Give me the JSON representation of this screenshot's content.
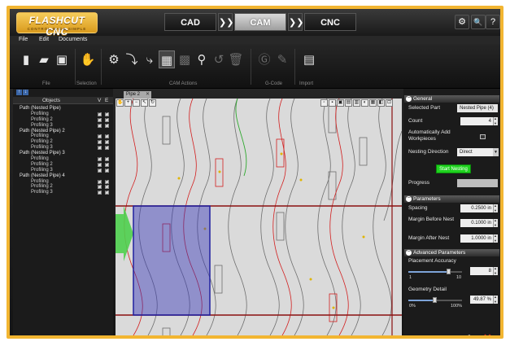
{
  "logo": {
    "title": "FLASHCUT CNC",
    "tagline": "CONTROL MADE SIMPLE"
  },
  "modes": {
    "cad": "CAD",
    "cam": "CAM",
    "cnc": "CNC",
    "chevron": "❯❯"
  },
  "toolbar_right": {
    "settings": "⚙",
    "search": "🔍",
    "help": "?"
  },
  "menu": {
    "file": "File",
    "edit": "Edit",
    "documents": "Documents"
  },
  "ribbon_groups": {
    "file": "File",
    "selection": "Selection",
    "cam_actions": "CAM Actions",
    "gcode": "G-Code",
    "import": "Import"
  },
  "tree": {
    "header": "Objects",
    "col_v": "V",
    "col_e": "E",
    "rows": [
      {
        "label": "Path (Nested Pipe)",
        "type": "parent"
      },
      {
        "label": "Profiling",
        "type": "child"
      },
      {
        "label": "Profiling 2",
        "type": "child"
      },
      {
        "label": "Profiling 3",
        "type": "child"
      },
      {
        "label": "Path (Nested Pipe) 2",
        "type": "parent"
      },
      {
        "label": "Profiling",
        "type": "child"
      },
      {
        "label": "Profiling 2",
        "type": "child"
      },
      {
        "label": "Profiling 3",
        "type": "child"
      },
      {
        "label": "Path (Nested Pipe) 3",
        "type": "parent"
      },
      {
        "label": "Profiling",
        "type": "child"
      },
      {
        "label": "Profiling 2",
        "type": "child"
      },
      {
        "label": "Profiling 3",
        "type": "child"
      },
      {
        "label": "Path (Nested Pipe) 4",
        "type": "parent"
      },
      {
        "label": "Profiling",
        "type": "child"
      },
      {
        "label": "Profiling 2",
        "type": "child"
      },
      {
        "label": "Profiling 3",
        "type": "child"
      }
    ]
  },
  "canvas": {
    "tab_label": "Pipe 2",
    "tab_close": "✕"
  },
  "general": {
    "heading": "General",
    "selected_part_label": "Selected Part",
    "selected_part_value": "Nested Pipe (4)",
    "count_label": "Count",
    "count_value": "4",
    "auto_add_label": "Automatically Add Workpieces",
    "nesting_direction_label": "Nesting Direction",
    "nesting_direction_value": "Direct",
    "start_button": "Start Nesting",
    "progress_label": "Progress",
    "progress_fraction": 0
  },
  "parameters": {
    "heading": "Parameters",
    "spacing_label": "Spacing",
    "spacing_value": "0.2500 in",
    "margin_before_label": "Margin Before Nest",
    "margin_before_value": "0.1000 in",
    "margin_after_label": "Margin After Nest",
    "margin_after_value": "1.0000 in"
  },
  "advanced": {
    "heading": "Advanced Parameters",
    "accuracy_label": "Placement Accuracy",
    "accuracy_value": "8",
    "accuracy_min": "1",
    "accuracy_max": "10",
    "accuracy_level": 8,
    "detail_label": "Geometry Detail",
    "detail_value": "49.87 %",
    "detail_min": "0%",
    "detail_max": "100%",
    "detail_level": 0.4987
  },
  "actions": {
    "ok": "✔",
    "cancel": "✖"
  },
  "colors": {
    "frame": "#f2b531",
    "selection": "#3535b8",
    "cut_path": "#d21e1e",
    "accent_path": "#2ea82e",
    "start_button": "#1fd21f"
  }
}
